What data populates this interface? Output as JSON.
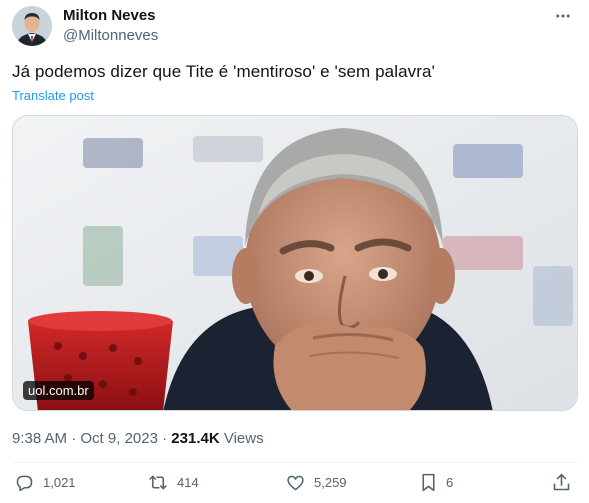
{
  "author": {
    "name": "Milton Neves",
    "handle": "@Miltonneves"
  },
  "tweet": {
    "text": "Já podemos dizer que Tite é 'mentiroso' e 'sem palavra'",
    "translate_label": "Translate post"
  },
  "media": {
    "source_label": "uol.com.br"
  },
  "meta": {
    "time": "9:38 AM",
    "separator": "·",
    "date": "Oct 9, 2023",
    "separator2": "·",
    "views_count": "231.4K",
    "views_label": "Views"
  },
  "actions": {
    "replies": "1,021",
    "reposts": "414",
    "likes": "5,259",
    "bookmarks": "6"
  },
  "icons": [
    "more-icon",
    "reply-icon",
    "repost-icon",
    "like-icon",
    "bookmark-icon",
    "share-icon"
  ],
  "colors": {
    "link": "#1d9bf0",
    "secondary_text": "#536471",
    "primary_text": "#0f1419"
  }
}
